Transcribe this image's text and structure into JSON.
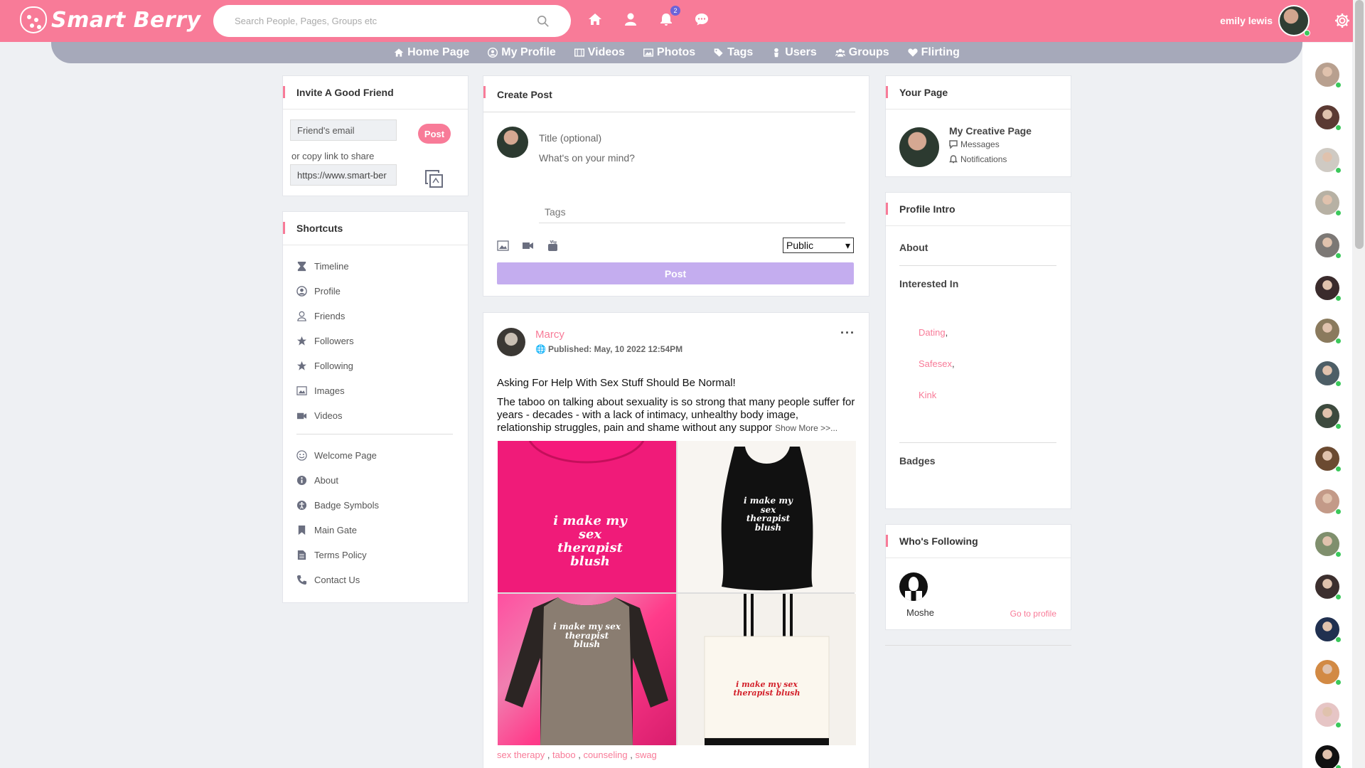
{
  "brand": {
    "name": "Smart Berry",
    "accent": "#f87b98",
    "nav_bg": "#a6a9ba",
    "purple": "#c4adef"
  },
  "search": {
    "placeholder": "Search People, Pages, Groups etc"
  },
  "header": {
    "notification_count": "2",
    "user_name": "emily lewis",
    "icons": [
      "home-icon",
      "user-icon",
      "bell-icon",
      "chat-icon",
      "gear-icon"
    ]
  },
  "nav": {
    "items": [
      {
        "label": "Home Page",
        "icon": "home-icon"
      },
      {
        "label": "My Profile",
        "icon": "user-circle-icon"
      },
      {
        "label": "Videos",
        "icon": "film-icon"
      },
      {
        "label": "Photos",
        "icon": "image-icon"
      },
      {
        "label": "Tags",
        "icon": "tags-icon"
      },
      {
        "label": "Users",
        "icon": "user-icon"
      },
      {
        "label": "Groups",
        "icon": "users-icon"
      },
      {
        "label": "Flirting",
        "icon": "heart-icon"
      }
    ]
  },
  "invite": {
    "title": "Invite A Good Friend",
    "email_placeholder": "Friend's email",
    "post_label": "Post",
    "copy_text": "or copy link to share",
    "link_value": "https://www.smart-ber"
  },
  "shortcuts": {
    "title": "Shortcuts",
    "primary": [
      {
        "label": "Timeline",
        "icon": "hourglass-icon"
      },
      {
        "label": "Profile",
        "icon": "user-circle-icon"
      },
      {
        "label": "Friends",
        "icon": "user-outline-icon"
      },
      {
        "label": "Followers",
        "icon": "star-icon"
      },
      {
        "label": "Following",
        "icon": "star-icon"
      },
      {
        "label": "Images",
        "icon": "image-icon"
      },
      {
        "label": "Videos",
        "icon": "video-icon"
      }
    ],
    "secondary": [
      {
        "label": "Welcome Page",
        "icon": "smile-icon"
      },
      {
        "label": "About",
        "icon": "info-icon"
      },
      {
        "label": "Badge Symbols",
        "icon": "accessibility-icon"
      },
      {
        "label": "Main Gate",
        "icon": "bookmark-icon"
      },
      {
        "label": "Terms Policy",
        "icon": "document-icon"
      },
      {
        "label": "Contact Us",
        "icon": "phone-icon"
      }
    ]
  },
  "create_post": {
    "title": "Create Post",
    "title_placeholder": "Title (optional)",
    "body_placeholder": "What's on your mind?",
    "tags_placeholder": "Tags",
    "visibility": "Public",
    "post_label": "Post",
    "media_icons": [
      "image-icon",
      "video-camera-icon",
      "youtube-icon"
    ]
  },
  "post": {
    "author": "Marcy",
    "published": "Published: May, 10 2022 12:54PM",
    "headline": "Asking For Help With Sex Stuff Should Be Normal!",
    "text": "The taboo on talking about sexuality is so strong that many people suffer for years - decades - with a lack of intimacy, unhealthy body image, relationship struggles, pain and shame without any suppor",
    "show_more": "Show More >>...",
    "images": [
      {
        "caption": "i make my sex therapist blush",
        "bg": "#f5197b"
      },
      {
        "caption": "i make my sex therapist blush",
        "bg": "#f8f5f1"
      },
      {
        "caption": "i make my sex therapist blush",
        "bg": "#f07fb0"
      },
      {
        "caption": "i make my sex therapist blush",
        "bg": "#f4f1ec"
      }
    ],
    "tags": [
      "sex therapy",
      "taboo",
      "counseling",
      "swag"
    ]
  },
  "your_page": {
    "title": "Your Page",
    "page_name": "My Creative Page",
    "messages": "Messages",
    "notifications": "Notifications"
  },
  "profile_intro": {
    "title": "Profile Intro",
    "about": "About",
    "interested_in": "Interested In",
    "interests": [
      "Dating",
      "Safesex",
      "Kink"
    ],
    "badges": "Badges"
  },
  "following": {
    "title": "Who's Following",
    "name": "Moshe",
    "link": "Go to profile"
  },
  "online_users": [
    {
      "tone": "#b8a08f"
    },
    {
      "tone": "#5b3a33"
    },
    {
      "tone": "#cfcac3"
    },
    {
      "tone": "#b7b1a4"
    },
    {
      "tone": "#7c7875"
    },
    {
      "tone": "#3a2b2c"
    },
    {
      "tone": "#8a7a5d"
    },
    {
      "tone": "#4d5e66"
    },
    {
      "tone": "#3d4a3e"
    },
    {
      "tone": "#6b4a31"
    },
    {
      "tone": "#c39a88"
    },
    {
      "tone": "#7f8f6d"
    },
    {
      "tone": "#3c2f2e"
    },
    {
      "tone": "#203050"
    },
    {
      "tone": "#d28a44"
    },
    {
      "tone": "#e6c5c5"
    },
    {
      "tone": "#111111"
    }
  ]
}
